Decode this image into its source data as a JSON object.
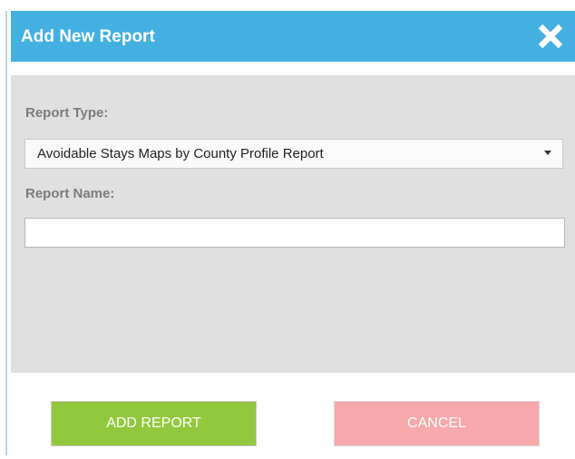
{
  "dialog": {
    "title": "Add New Report",
    "close_icon": "close-x-icon"
  },
  "form": {
    "report_type_label": "Report Type:",
    "report_type_value": "Avoidable Stays Maps by County Profile Report",
    "report_name_label": "Report Name:",
    "report_name_value": "",
    "report_name_placeholder": ""
  },
  "actions": {
    "add_label": "ADD REPORT",
    "cancel_label": "CANCEL"
  },
  "colors": {
    "header": "#43b0e1",
    "add_button": "#92c83e",
    "cancel_button": "#f7a8ab",
    "panel": "#e0e0e0"
  }
}
